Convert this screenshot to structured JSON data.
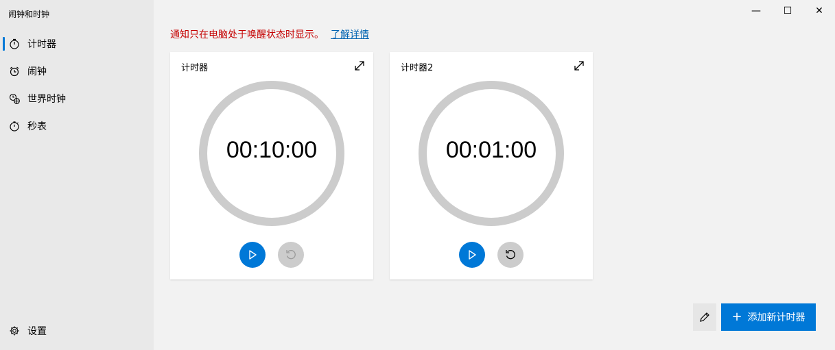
{
  "app": {
    "title": "闹钟和时钟"
  },
  "window_controls": {
    "minimize": "—",
    "maximize": "☐",
    "close": "✕"
  },
  "sidebar": {
    "items": [
      {
        "label": "计时器",
        "icon": "timer-icon",
        "active": true
      },
      {
        "label": "闹钟",
        "icon": "alarm-icon"
      },
      {
        "label": "世界时钟",
        "icon": "world-clock-icon"
      },
      {
        "label": "秒表",
        "icon": "stopwatch-icon"
      }
    ],
    "settings": {
      "label": "设置",
      "icon": "gear-icon"
    }
  },
  "notice": {
    "text": "通知只在电脑处于唤醒状态时显示。",
    "link": "了解详情"
  },
  "timers": [
    {
      "name": "计时器",
      "time": "00:10:00"
    },
    {
      "name": "计时器2",
      "time": "00:01:00"
    }
  ],
  "actions": {
    "add_timer": "添加新计时器"
  },
  "colors": {
    "accent": "#0078d7",
    "notice": "#c50000",
    "ring": "#cccccc"
  }
}
